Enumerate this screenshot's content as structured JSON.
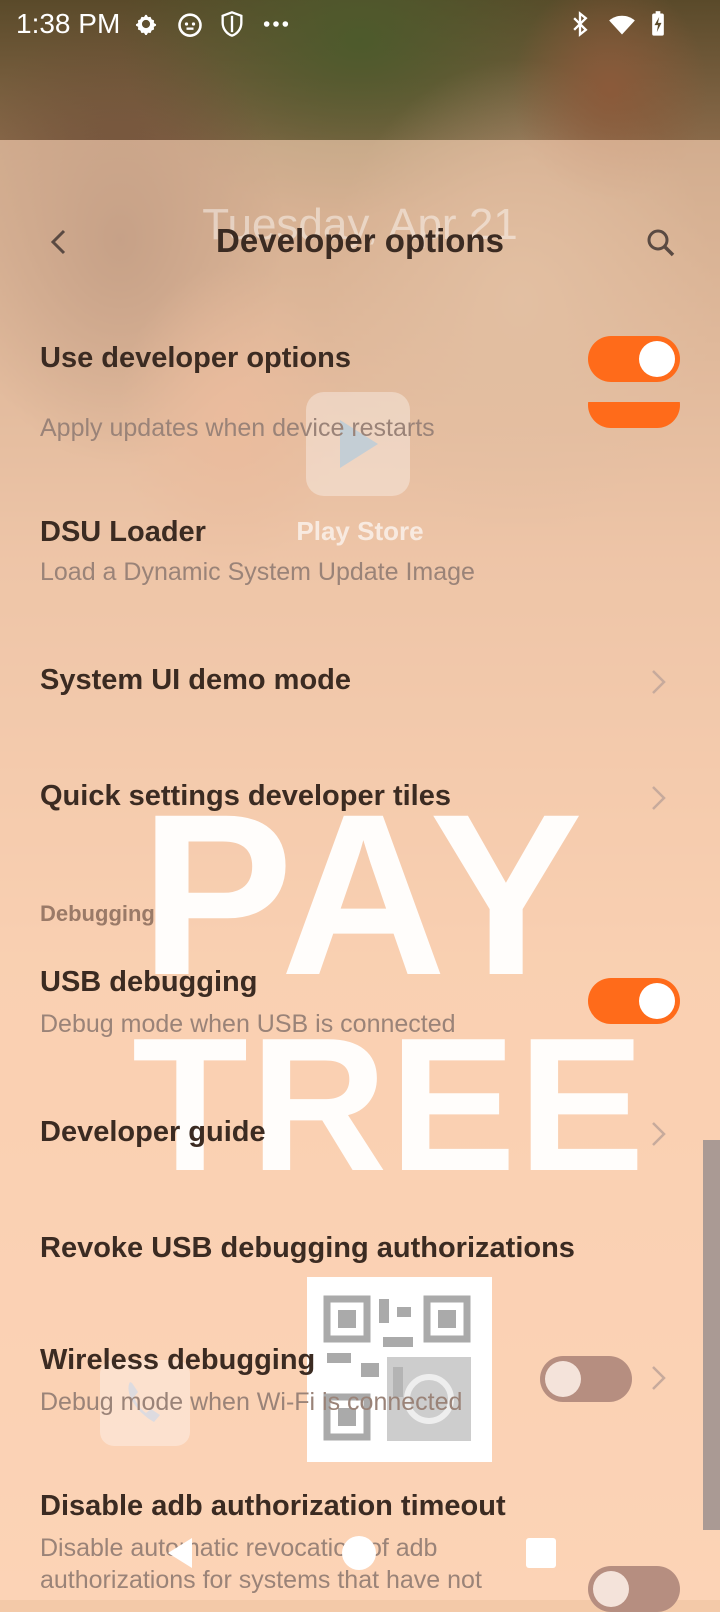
{
  "status_bar": {
    "time": "1:38 PM"
  },
  "background": {
    "ghost_date": "Tuesday, Apr 21",
    "ghost_app_label": "Play Store"
  },
  "header": {
    "title": "Developer options"
  },
  "settings": {
    "use_developer_options": {
      "title": "Use developer options",
      "on": true
    },
    "auto_update": {
      "subtitle": "Apply updates when device restarts"
    },
    "dsu_loader": {
      "title": "DSU Loader",
      "subtitle": "Load a Dynamic System Update Image"
    },
    "demo_mode": {
      "title": "System UI demo mode"
    },
    "quick_tiles": {
      "title": "Quick settings developer tiles"
    },
    "debugging_header": "Debugging",
    "usb_debugging": {
      "title": "USB debugging",
      "subtitle": "Debug mode when USB is connected",
      "on": true
    },
    "developer_guide": {
      "title": "Developer guide"
    },
    "revoke_usb": {
      "title": "Revoke USB debugging authorizations"
    },
    "wireless_debugging": {
      "title": "Wireless debugging",
      "subtitle": "Debug mode when Wi-Fi is connected",
      "on": false
    },
    "adb_timeout": {
      "title": "Disable adb authorization timeout",
      "subtitle_line1": "Disable automatic revocation of adb",
      "subtitle_line2": "authorizations for systems that have not",
      "on": false
    }
  },
  "watermark": {
    "line1": "PAY",
    "line2": "TREE"
  },
  "colors": {
    "accent": "#ff6b1a",
    "title_text": "#3b2b22",
    "subtitle_text": "#9a8378"
  }
}
